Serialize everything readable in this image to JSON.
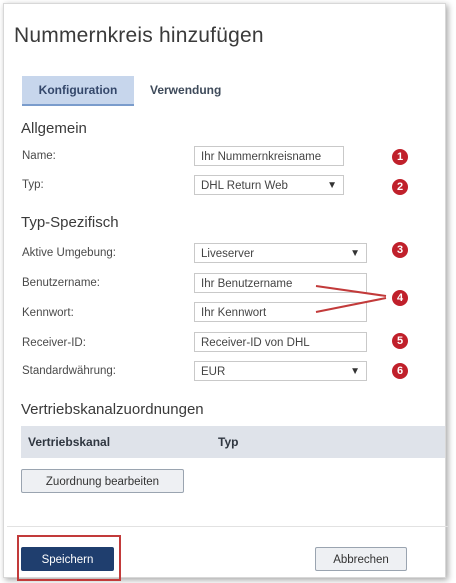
{
  "dialog": {
    "title": "Nummernkreis hinzufügen",
    "tabs": [
      {
        "label": "Konfiguration",
        "active": true
      },
      {
        "label": "Verwendung",
        "active": false
      }
    ]
  },
  "sections": {
    "general": "Allgemein",
    "type_specific": "Typ-Spezifisch",
    "channels": "Vertriebskanalzuordnungen"
  },
  "fields": {
    "name": {
      "label": "Name:",
      "value": "Ihr Nummernkreisname"
    },
    "typ": {
      "label": "Typ:",
      "value": "DHL Return Web"
    },
    "environment": {
      "label": "Aktive Umgebung:",
      "value": "Liveserver"
    },
    "username": {
      "label": "Benutzername:",
      "value": "Ihr Benutzername"
    },
    "password": {
      "label": "Kennwort:",
      "value": "Ihr Kennwort"
    },
    "receiver": {
      "label": "Receiver-ID:",
      "value": "Receiver-ID von DHL"
    },
    "currency": {
      "label": "Standardwährung:",
      "value": "EUR"
    }
  },
  "badges": [
    "1",
    "2",
    "3",
    "4",
    "5",
    "6"
  ],
  "table": {
    "headers": [
      "Vertriebskanal",
      "Typ"
    ]
  },
  "buttons": {
    "edit_assignment": "Zuordnung bearbeiten",
    "save": "Speichern",
    "cancel": "Abbrechen"
  },
  "colors": {
    "badge": "#c0202b",
    "primary": "#1f3e6e",
    "annotation": "#c23a3a"
  },
  "icons": {
    "dropdown": "chevron-down-icon"
  }
}
